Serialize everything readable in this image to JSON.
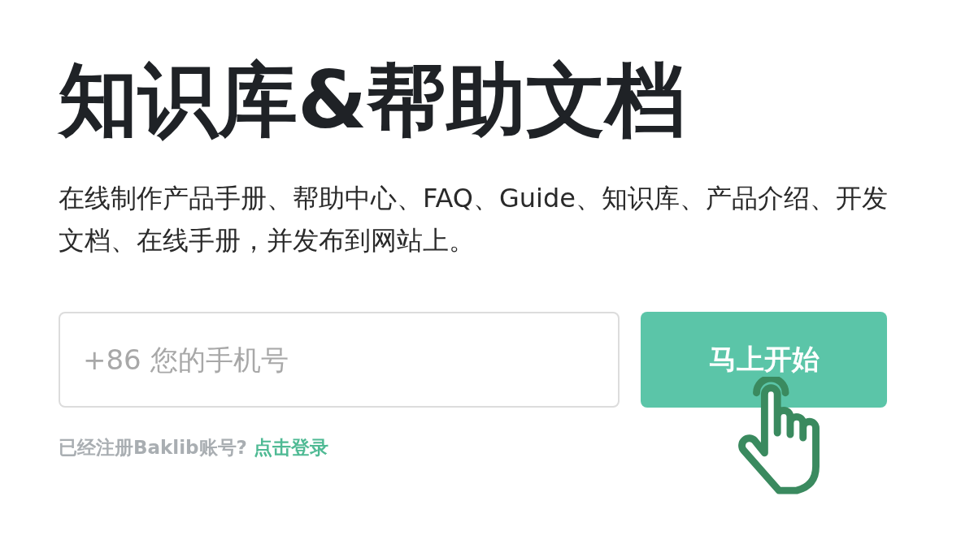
{
  "title": "知识库&帮助文档",
  "subtitle": "在线制作产品手册、帮助中心、FAQ、Guide、知识库、产品介绍、开发文档、在线手册，并发布到网站上。",
  "phone_field": {
    "placeholder": "+86 您的手机号"
  },
  "start_button": {
    "label": "马上开始"
  },
  "login_prompt": {
    "text": "已经注册Baklib账号?",
    "link": "点击登录"
  }
}
